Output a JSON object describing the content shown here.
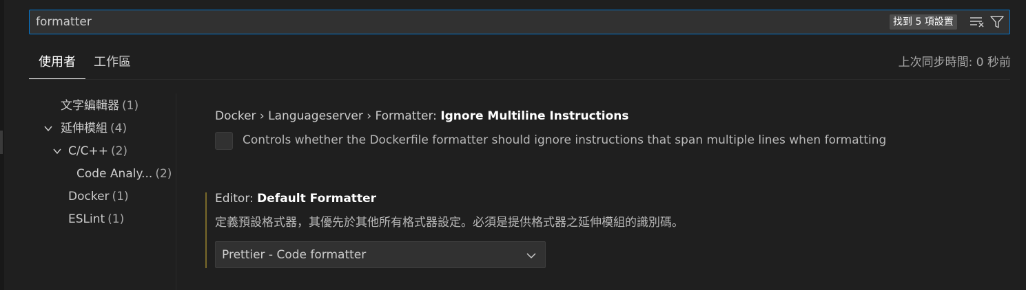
{
  "search": {
    "value": "formatter",
    "result_count": "找到 5 項設置",
    "clear_icon": "clear-filter-icon",
    "filter_icon": "filter-icon"
  },
  "tabs": [
    {
      "label": "使用者",
      "active": true
    },
    {
      "label": "工作區",
      "active": false
    }
  ],
  "sync_status": "上次同步時間: 0 秒前",
  "tree": {
    "items": [
      {
        "label": "文字編輯器",
        "count": "(1)"
      },
      {
        "label": "延伸模組",
        "count": "(4)",
        "expanded": true
      },
      {
        "label": "C/C++",
        "count": "(2)",
        "expanded": true
      },
      {
        "label": "Code Analy...",
        "count": "(2)"
      },
      {
        "label": "Docker",
        "count": "(1)"
      },
      {
        "label": "ESLint",
        "count": "(1)"
      }
    ]
  },
  "settings": [
    {
      "prefix": "Docker › Languageserver › Formatter: ",
      "key": "Ignore Multiline Instructions",
      "description": "Controls whether the Dockerfile formatter should ignore instructions that span multiple lines when formatting",
      "checked": false
    },
    {
      "prefix": "Editor: ",
      "key": "Default Formatter",
      "description": "定義預設格式器，其優先於其他所有格式器設定。必須是提供格式器之延伸模組的識別碼。",
      "value": "Prettier - Code formatter",
      "modified": true
    }
  ],
  "colors": {
    "background": "#1f1f1f",
    "focus_border": "#0078d4",
    "modified_indicator": "#7a6a2a"
  }
}
